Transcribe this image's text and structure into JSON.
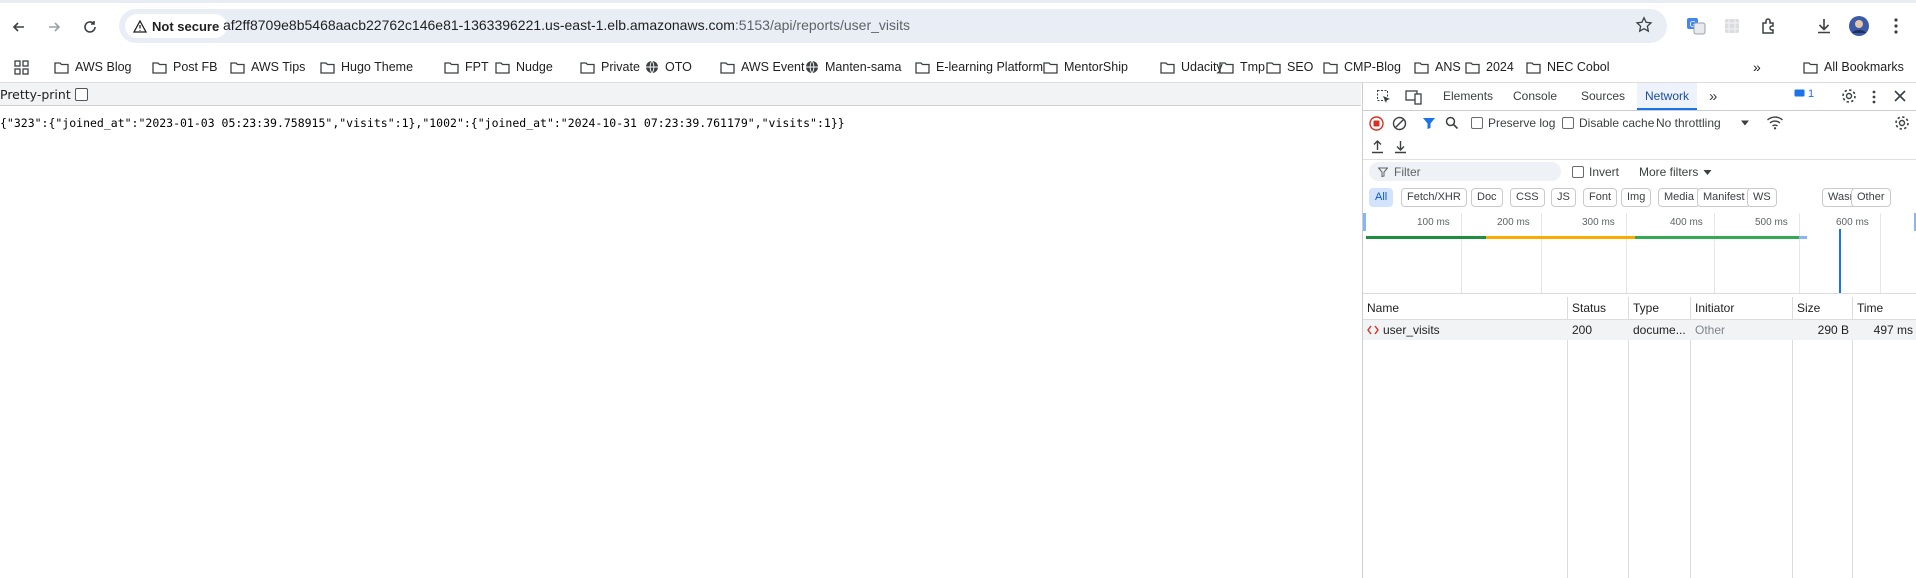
{
  "browser": {
    "security_label": "Not secure",
    "url_host": "af2ff8709e8b5468aacb22762c146e81-1363396221.us-east-1.elb.amazonaws.com",
    "url_path": ":5153/api/reports/user_visits"
  },
  "bookmarks": {
    "items": [
      {
        "label": "AWS Blog",
        "icon": "folder-icon"
      },
      {
        "label": "Post FB",
        "icon": "folder-icon"
      },
      {
        "label": "AWS Tips",
        "icon": "folder-icon"
      },
      {
        "label": "Hugo Theme",
        "icon": "folder-icon"
      },
      {
        "label": "FPT",
        "icon": "folder-icon"
      },
      {
        "label": "Nudge",
        "icon": "folder-icon"
      },
      {
        "label": "Private",
        "icon": "folder-icon"
      },
      {
        "label": "OTO",
        "icon": "globe-icon"
      },
      {
        "label": "AWS Event",
        "icon": "folder-icon"
      },
      {
        "label": "Manten-sama",
        "icon": "globe-icon"
      },
      {
        "label": "E-learning Platform",
        "icon": "folder-icon"
      },
      {
        "label": "MentorShip",
        "icon": "folder-icon"
      },
      {
        "label": "Udacity",
        "icon": "folder-icon"
      },
      {
        "label": "Tmp",
        "icon": "folder-icon"
      },
      {
        "label": "SEO",
        "icon": "folder-icon"
      },
      {
        "label": "CMP-Blog",
        "icon": "folder-icon"
      },
      {
        "label": "ANS",
        "icon": "folder-icon"
      },
      {
        "label": "2024",
        "icon": "folder-icon"
      },
      {
        "label": "NEC Cobol",
        "icon": "folder-icon"
      }
    ],
    "overflow": "»",
    "all_bookmarks": "All Bookmarks"
  },
  "page": {
    "pretty_print_label": "Pretty-print",
    "json_text": "{\"323\":{\"joined_at\":\"2023-01-03 05:23:39.758915\",\"visits\":1},\"1002\":{\"joined_at\":\"2024-10-31 07:23:39.761179\",\"visits\":1}}"
  },
  "devtools": {
    "tabs": [
      "Elements",
      "Console",
      "Sources",
      "Network"
    ],
    "active_tab": "Network",
    "more_tabs": "»",
    "issues_count": "1",
    "preserve_log": "Preserve log",
    "disable_cache": "Disable cache",
    "throttling": "No throttling",
    "filter_placeholder": "Filter",
    "invert": "Invert",
    "more_filters": "More filters",
    "type_filters": [
      "All",
      "Fetch/XHR",
      "Doc",
      "CSS",
      "JS",
      "Font",
      "Img",
      "Media",
      "Manifest",
      "WS",
      "Wasm",
      "Other"
    ],
    "timeline_ticks": [
      "100 ms",
      "200 ms",
      "300 ms",
      "400 ms",
      "500 ms",
      "600 ms"
    ],
    "columns": [
      "Name",
      "Status",
      "Type",
      "Initiator",
      "Size",
      "Time"
    ],
    "rows": [
      {
        "name": "user_visits",
        "status": "200",
        "type": "docume...",
        "initiator": "Other",
        "size": "290 B",
        "time": "497 ms"
      }
    ],
    "colors": {
      "accent": "#1a73e8",
      "stop_red": "#d93025",
      "wait_green": "#1e8e3e",
      "wait_yellow": "#f9ab00",
      "download_green": "#34a853"
    }
  }
}
